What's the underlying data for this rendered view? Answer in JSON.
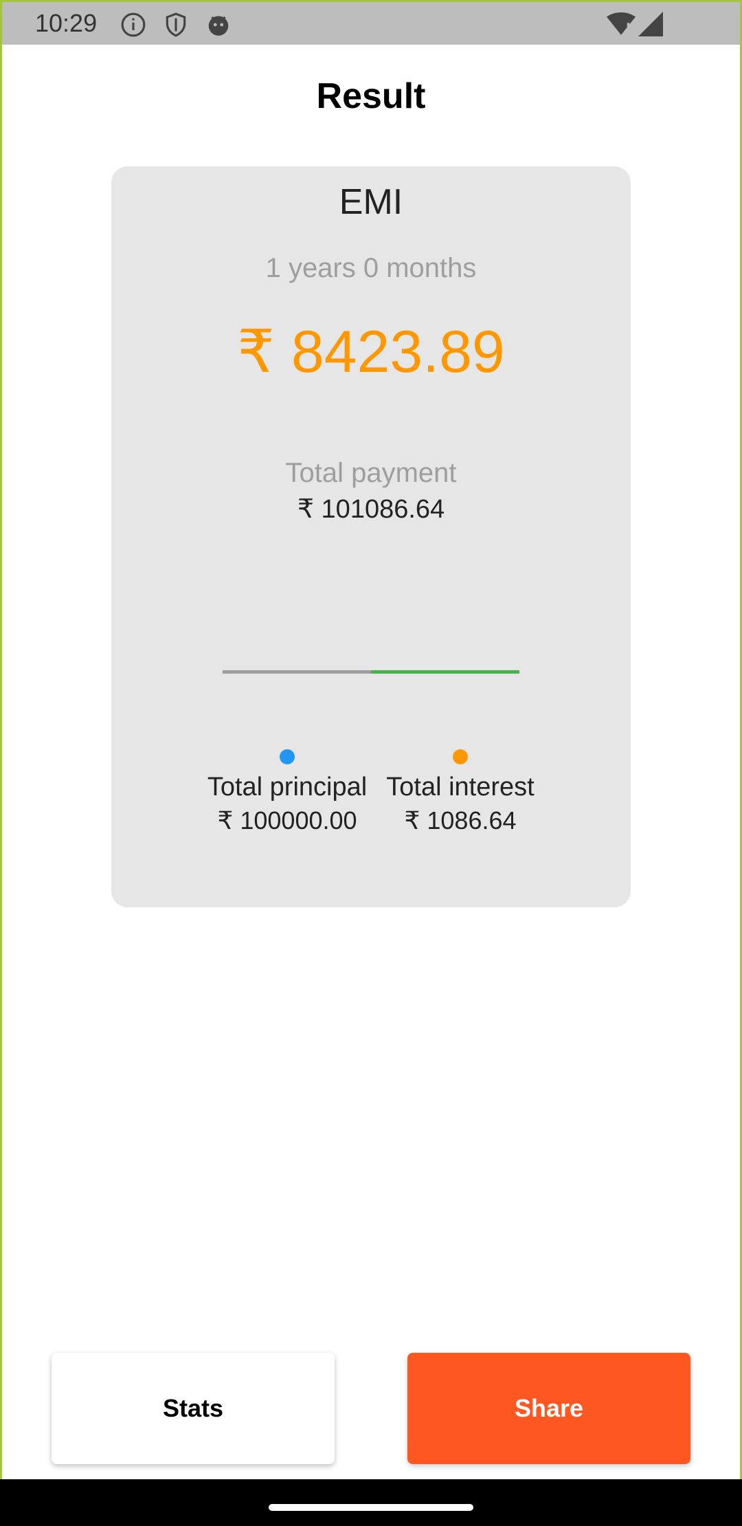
{
  "status_bar": {
    "time": "10:29",
    "icons": [
      "info-icon",
      "shield-icon",
      "android-icon",
      "wifi-icon",
      "signal-icon"
    ]
  },
  "header": {
    "title": "Result"
  },
  "result_card": {
    "emi_label": "EMI",
    "tenure": "1 years 0 months",
    "emi_amount": "₹ 8423.89",
    "total_payment_label": "Total payment",
    "total_payment_value": "₹ 101086.64",
    "legend": {
      "principal": {
        "label": "Total principal",
        "value": "₹ 100000.00",
        "color": "#2196f3"
      },
      "interest": {
        "label": "Total interest",
        "value": "₹ 1086.64",
        "color": "#ff9800"
      }
    }
  },
  "actions": {
    "stats_label": "Stats",
    "share_label": "Share"
  },
  "colors": {
    "accent_orange": "#ff9800",
    "share_button": "#ff5722",
    "card_bg": "#e6e6e6"
  }
}
